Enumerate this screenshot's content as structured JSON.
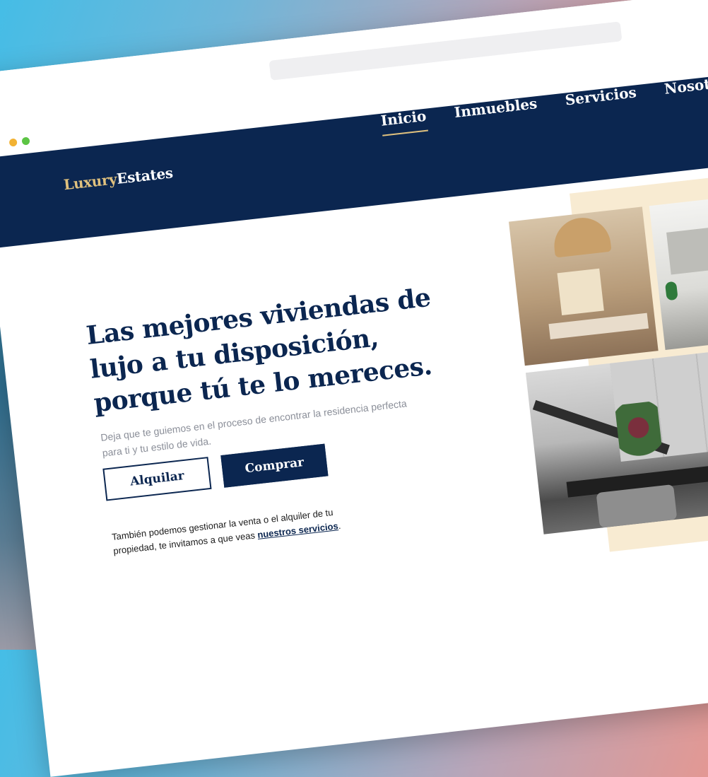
{
  "nav": {
    "brand_part1": "Luxury",
    "brand_part2": "Estates",
    "links": [
      {
        "label": "Inicio",
        "active": true
      },
      {
        "label": "Inmuebles",
        "active": false
      },
      {
        "label": "Servicios",
        "active": false
      },
      {
        "label": "Nosotros",
        "active": false
      }
    ]
  },
  "hero": {
    "title": "Las mejores viviendas de lujo a tu disposición, porque tú te lo mereces.",
    "subtitle": "Deja que te guiemos en el proceso de encontrar la residencia perfecta para ti y tu estilo de vida.",
    "buttons": {
      "rent": "Alquilar",
      "buy": "Comprar"
    },
    "footnote_prefix": "También podemos gestionar la venta o el alquiler de tu propiedad, te invitamos a que veas ",
    "footnote_link": "nuestros servicios",
    "footnote_suffix": "."
  },
  "colors": {
    "navy": "#0b2650",
    "gold": "#e0c17e",
    "cream_accent": "#f8ebd2"
  }
}
